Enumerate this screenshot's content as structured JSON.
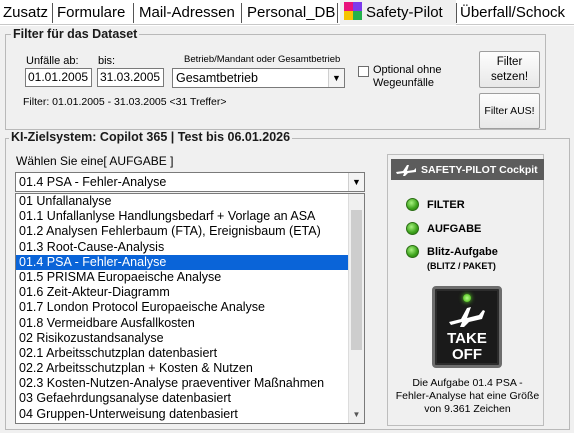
{
  "tabs": [
    {
      "label": "Zusatz"
    },
    {
      "label": "Formulare"
    },
    {
      "label": "Mail-Adressen"
    },
    {
      "label": "Personal_DB"
    },
    {
      "label": "Safety-Pilot",
      "active": true
    },
    {
      "label": "Überfall/Schock"
    }
  ],
  "filter": {
    "title": "Filter für das Dataset",
    "from_label": "Unfälle ab:",
    "from_value": "01.01.2005",
    "to_label": "bis:",
    "to_value": "31.03.2005",
    "company_label": "Betrieb/Mandant oder Gesamtbetrieb",
    "company_value": "Gesamtbetrieb",
    "optional_label_1": "Optional ohne",
    "optional_label_2": "Wegeunfälle",
    "optional_checked": false,
    "summary": "Filter: 01.01.2005 - 31.03.2005 <31 Treffer>",
    "apply_label_1": "Filter",
    "apply_label_2": "setzen!",
    "off_label": "Filter AUS!"
  },
  "ki": {
    "title": "KI-Zielsystem: Copilot 365 | Test bis 06.01.2026",
    "task_label": "Wählen Sie eine[ AUFGABE ]",
    "task_value": "01.4 PSA - Fehler-Analyse",
    "selected_index": 4,
    "tasks": [
      "01 Unfallanalyse",
      "01.1 Unfallanlyse Handlungsbedarf + Vorlage an ASA",
      "01.2 Analysen Fehlerbaum (FTA), Ereignisbaum (ETA)",
      "01.3 Root-Cause-Analysis",
      "01.4 PSA - Fehler-Analyse",
      "01.5 PRISMA Europaeische Analyse",
      "01.6 Zeit-Akteur-Diagramm",
      "01.7 London Protocol Europaeische Analyse",
      "01.8 Vermeidbare Ausfallkosten",
      "02 Risikozustandsanalyse",
      "02.1 Arbeitsschutzplan datenbasiert",
      "02.2 Arbeitsschutzplan + Kosten & Nutzen",
      "02.3 Kosten-Nutzen-Analyse praeventiver Maßnahmen",
      "03 Gefaehrdungsanalyse datenbasiert",
      "04 Gruppen-Unterweisung datenbasiert"
    ]
  },
  "cockpit": {
    "title": "SAFETY-PILOT Cockpit",
    "status_filter": "FILTER",
    "status_task": "AUFGABE",
    "status_blitz_1": "Blitz-Aufgabe",
    "status_blitz_2": "(BLITZ / PAKET)",
    "takeoff_line1": "TAKE",
    "takeoff_line2": "OFF",
    "info_1": "Die Aufgabe 01.4 PSA -",
    "info_2": "Fehler-Analyse hat eine Größe",
    "info_3": "von 9.361 Zeichen",
    "led_color": "#3ba11a"
  }
}
